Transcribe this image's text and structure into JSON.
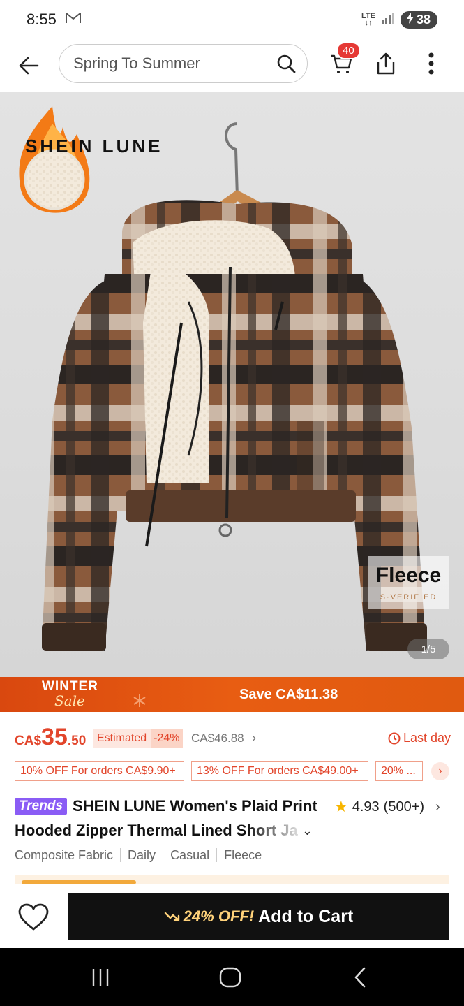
{
  "status": {
    "time": "8:55",
    "network": "LTE",
    "battery": "38"
  },
  "header": {
    "search_placeholder": "Spring To Summer",
    "cart_count": "40"
  },
  "product": {
    "brand_logo": "SHEIN LUNE",
    "badge_title": "Fleece",
    "badge_subtitle": "S·VERIFIED",
    "image_counter": "1/5"
  },
  "promo": {
    "logo_line1": "WINTER",
    "logo_line2": "Sale",
    "save_text": "Save CA$11.38"
  },
  "price": {
    "currency": "CA$",
    "amount": "35",
    "cents": ".50",
    "estimated_label": "Estimated",
    "discount_pct": "-24%",
    "original": "CA$46.88",
    "deadline": "Last day"
  },
  "coupons": [
    "10% OFF For orders CA$9.90+",
    "13% OFF For orders CA$49.00+",
    "20% ..."
  ],
  "title": {
    "badge": "Trends",
    "line1": "SHEIN LUNE Women's Plaid Print",
    "line2": "Hooded Zipper Thermal Lined Short Ja",
    "rating": "4.93",
    "rating_count": "(500+)"
  },
  "tags": [
    "Composite Fabric",
    "Daily",
    "Casual",
    "Fleece"
  ],
  "cta": {
    "discount": "24% OFF!",
    "label": "Add to Cart"
  },
  "colors": {
    "accent_red": "#e2452b",
    "promo_orange": "#e85d12",
    "trends_purple": "#8a5cf5",
    "cta_black": "#111111"
  }
}
